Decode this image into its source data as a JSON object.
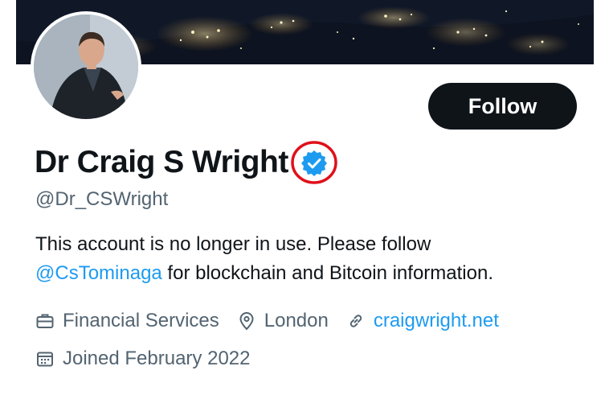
{
  "profile": {
    "follow_label": "Follow",
    "display_name": "Dr Craig S Wright",
    "handle": "@Dr_CSWright",
    "bio_before": "This account is no longer in use. Please follow",
    "bio_mention": "@CsTominaga",
    "bio_after": " for blockchain and Bitcoin information.",
    "category": "Financial Services",
    "location": "London",
    "website": "craigwright.net",
    "joined": "Joined February 2022"
  },
  "icons": {
    "verified": "verified-badge-icon",
    "category": "briefcase-icon",
    "location": "location-pin-icon",
    "website": "link-icon",
    "joined": "calendar-icon"
  },
  "colors": {
    "accent": "#1d9bf0",
    "follow_bg": "#0f1419",
    "secondary_text": "#536471",
    "highlight_circle": "#e0101a"
  }
}
